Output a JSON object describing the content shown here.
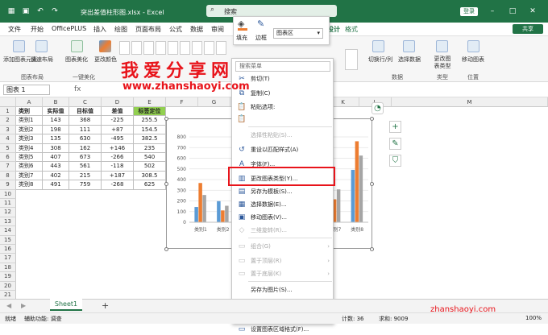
{
  "titlebar": {
    "filename": "突出差值柱形图.xlsx - Excel",
    "search_placeholder": "搜索",
    "login": "登录"
  },
  "menu": {
    "items": [
      "文件",
      "开始",
      "OfficePLUS",
      "插入",
      "绘图",
      "页面布局",
      "公式",
      "数据",
      "审阅"
    ],
    "chart_design": "表设计",
    "format": "格式",
    "share": "共享"
  },
  "mini_toolbar": {
    "fill": "填充",
    "outline": "边框",
    "element": "图表区"
  },
  "ribbon": {
    "add_element": "添加图表元素",
    "quick_layout": "快速布局",
    "beautify": "图表美化",
    "change_colors": "更改颜色",
    "switch_row_col": "切换行/列",
    "select_data": "选择数据",
    "change_type": "更改图表类型",
    "move_chart": "移动图表",
    "groups": [
      "图表布局",
      "一键美化",
      "数据",
      "类型",
      "位置"
    ]
  },
  "namebox": "图表 1",
  "columns": [
    "A",
    "B",
    "C",
    "D",
    "E",
    "F",
    "G",
    "H",
    "I",
    "J",
    "K",
    "L",
    "M"
  ],
  "rows": [
    "1",
    "2",
    "3",
    "4",
    "5",
    "6",
    "7",
    "8",
    "9",
    "10",
    "11",
    "12",
    "13",
    "14",
    "15",
    "16",
    "17",
    "18",
    "19",
    "20",
    "21"
  ],
  "table": {
    "headers": [
      "类别",
      "实际值",
      "目标值",
      "差值",
      "标签定位"
    ],
    "rows": [
      [
        "类别1",
        "143",
        "368",
        "-225",
        "255.5"
      ],
      [
        "类别2",
        "198",
        "111",
        "+87",
        "154.5"
      ],
      [
        "类别3",
        "135",
        "630",
        "-495",
        "382.5"
      ],
      [
        "类别4",
        "308",
        "162",
        "+146",
        "235"
      ],
      [
        "类别5",
        "407",
        "673",
        "-266",
        "540"
      ],
      [
        "类别6",
        "443",
        "561",
        "-118",
        "502"
      ],
      [
        "类别7",
        "402",
        "215",
        "+187",
        "308.5"
      ],
      [
        "类别8",
        "491",
        "759",
        "-268",
        "625"
      ]
    ]
  },
  "chart_data": {
    "type": "bar",
    "categories": [
      "类别1",
      "类别2",
      "类别3",
      "类别4",
      "类别5",
      "类别6",
      "类别7",
      "类别8"
    ],
    "series": [
      {
        "name": "实际值",
        "values": [
          143,
          198,
          135,
          308,
          407,
          443,
          402,
          491
        ],
        "color": "#5b9bd5"
      },
      {
        "name": "目标值",
        "values": [
          368,
          111,
          630,
          162,
          673,
          561,
          215,
          759
        ],
        "color": "#ed7d31"
      },
      {
        "name": "标签定位",
        "values": [
          255.5,
          154.5,
          382.5,
          235,
          540,
          502,
          308.5,
          625
        ],
        "color": "#a5a5a5"
      }
    ],
    "yticks": [
      "0",
      "100",
      "200",
      "300",
      "400",
      "500",
      "600",
      "700",
      "800"
    ],
    "ylim": [
      0,
      800
    ],
    "visible_category_labels": [
      "类别1",
      "类别2",
      "类别7",
      "类别8"
    ]
  },
  "context_menu": {
    "search": "搜索菜单",
    "items": [
      {
        "label": "剪切(T)",
        "icon": "✂",
        "disabled": false
      },
      {
        "label": "复制(C)",
        "icon": "⧉",
        "disabled": false
      },
      {
        "label": "粘贴选项:",
        "icon": "📋",
        "disabled": false
      },
      {
        "label": "",
        "icon": "📋",
        "disabled": false
      },
      {
        "label": "选择性粘贴(S)...",
        "icon": "",
        "disabled": true
      },
      {
        "label": "重设以匹配样式(A)",
        "icon": "↺",
        "disabled": false
      },
      {
        "label": "字体(F)...",
        "icon": "A",
        "disabled": false
      },
      {
        "label": "更改图表类型(Y)...",
        "icon": "▥",
        "disabled": false
      },
      {
        "label": "另存为模板(S)...",
        "icon": "▤",
        "disabled": false
      },
      {
        "label": "选择数据(E)...",
        "icon": "▦",
        "disabled": false
      },
      {
        "label": "移动图表(V)...",
        "icon": "▣",
        "disabled": false
      },
      {
        "label": "三维旋转(R)...",
        "icon": "◇",
        "disabled": true
      },
      {
        "label": "组合(G)",
        "icon": "▭",
        "disabled": true
      },
      {
        "label": "置于顶层(R)",
        "icon": "▭",
        "disabled": true
      },
      {
        "label": "置于底层(K)",
        "icon": "▭",
        "disabled": true
      },
      {
        "label": "另存为图片(S)...",
        "icon": "",
        "disabled": false
      },
      {
        "label": "指定宏(N)...",
        "icon": "",
        "disabled": false
      },
      {
        "label": "查看可选文字(A)...",
        "icon": "▭",
        "disabled": false
      },
      {
        "label": "设置图表区域格式(F)...",
        "icon": "▭",
        "disabled": false
      }
    ]
  },
  "sheets": {
    "tab": "Sheet1",
    "add": "+"
  },
  "status": {
    "ready": "就绪",
    "accessibility": "辅助功能: 调查",
    "count": "计数: 36",
    "sum": "求和: 9009",
    "zoom": "100%"
  },
  "watermark": {
    "cn": "我爱分享网",
    "url": "www.zhanshaoyi.com",
    "url2": "zhanshaoyi.com"
  }
}
